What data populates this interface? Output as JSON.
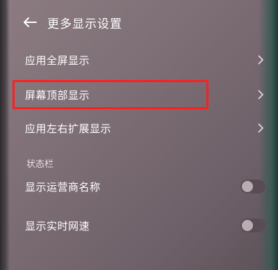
{
  "header": {
    "title": "更多显示设置",
    "back_icon": "arrow-left-icon"
  },
  "items": [
    {
      "label": "应用全屏显示",
      "control": "chevron"
    },
    {
      "label": "屏幕顶部显示",
      "control": "chevron",
      "highlighted": true
    },
    {
      "label": "应用左右扩展显示",
      "control": "chevron"
    }
  ],
  "status_section": {
    "label": "状态栏",
    "toggles": [
      {
        "label": "显示运营商名称",
        "enabled": false
      },
      {
        "label": "显示实时网速",
        "enabled": false
      }
    ]
  },
  "colors": {
    "highlight_border": "#ff1e1e",
    "text": "#ffffff"
  }
}
